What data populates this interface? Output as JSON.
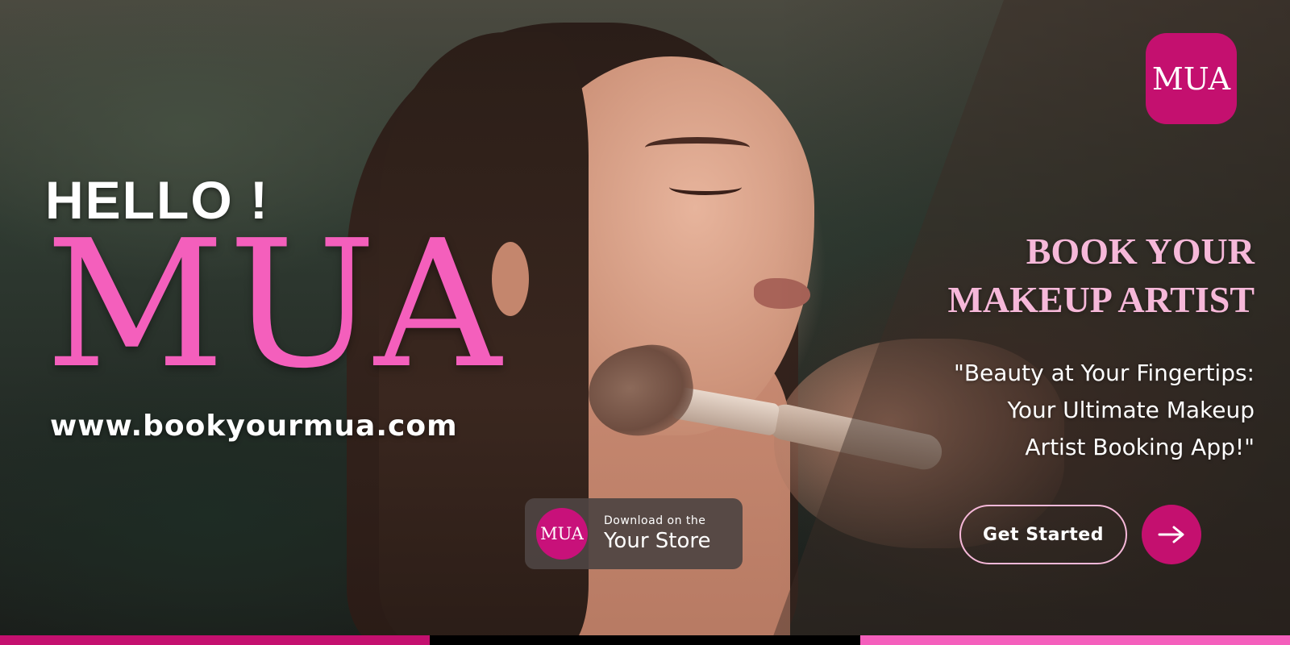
{
  "brand": {
    "logo_text": "MUA",
    "primary_color": "#c4106f",
    "accent_pink": "#f45fbc",
    "soft_pink": "#f6b8d9"
  },
  "hero": {
    "greeting": "HELLO !",
    "brand_name": "MUA",
    "website": "www.bookyourmua.com"
  },
  "store_badge": {
    "logo_text": "MUA",
    "small_text": "Download on the",
    "big_text": "Your Store"
  },
  "headline": {
    "line1": "BOOK YOUR",
    "line2": "MAKEUP ARTIST"
  },
  "tagline": {
    "line1": "\"Beauty at Your Fingertips:",
    "line2": "Your Ultimate Makeup",
    "line3": "Artist Booking App!\""
  },
  "cta": {
    "label": "Get Started",
    "arrow_icon": "arrow-right-icon"
  },
  "bottom_strip": {
    "colors": [
      "#c4106f",
      "#000000",
      "#f45fbc"
    ]
  }
}
